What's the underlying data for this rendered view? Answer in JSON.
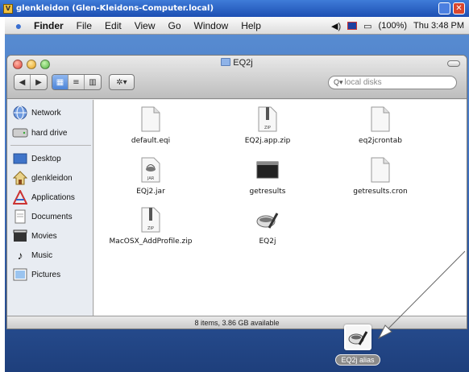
{
  "vnc_window": {
    "title": "glenkleidon (Glen-Kleidons-Computer.local)"
  },
  "menubar": {
    "app_name": "Finder",
    "items": [
      "File",
      "Edit",
      "View",
      "Go",
      "Window",
      "Help"
    ],
    "battery": "(100%)",
    "clock": "Thu 3:48 PM"
  },
  "finder": {
    "title": "EQ2j",
    "search_placeholder": "local disks",
    "status": "8 items, 3.86 GB available",
    "sidebar": [
      {
        "label": "Network",
        "icon": "network-icon"
      },
      {
        "label": "hard drive",
        "icon": "hard-drive-icon"
      },
      {
        "label": "Desktop",
        "icon": "desktop-icon"
      },
      {
        "label": "glenkleidon",
        "icon": "home-icon"
      },
      {
        "label": "Applications",
        "icon": "applications-icon"
      },
      {
        "label": "Documents",
        "icon": "documents-icon"
      },
      {
        "label": "Movies",
        "icon": "movies-icon"
      },
      {
        "label": "Music",
        "icon": "music-icon"
      },
      {
        "label": "Pictures",
        "icon": "pictures-icon"
      }
    ],
    "files": [
      {
        "name": "default.eqi",
        "icon": "document-icon"
      },
      {
        "name": "EQ2j.app.zip",
        "icon": "zip-icon"
      },
      {
        "name": "eq2jcrontab",
        "icon": "document-icon"
      },
      {
        "name": "EQj2.jar",
        "icon": "jar-icon"
      },
      {
        "name": "getresults",
        "icon": "terminal-icon"
      },
      {
        "name": "getresults.cron",
        "icon": "document-icon"
      },
      {
        "name": "MacOSX_AddProfile.zip",
        "icon": "zip-icon"
      },
      {
        "name": "EQ2j",
        "icon": "app-icon"
      }
    ]
  },
  "desktop": {
    "alias_label": "EQ2j alias"
  }
}
